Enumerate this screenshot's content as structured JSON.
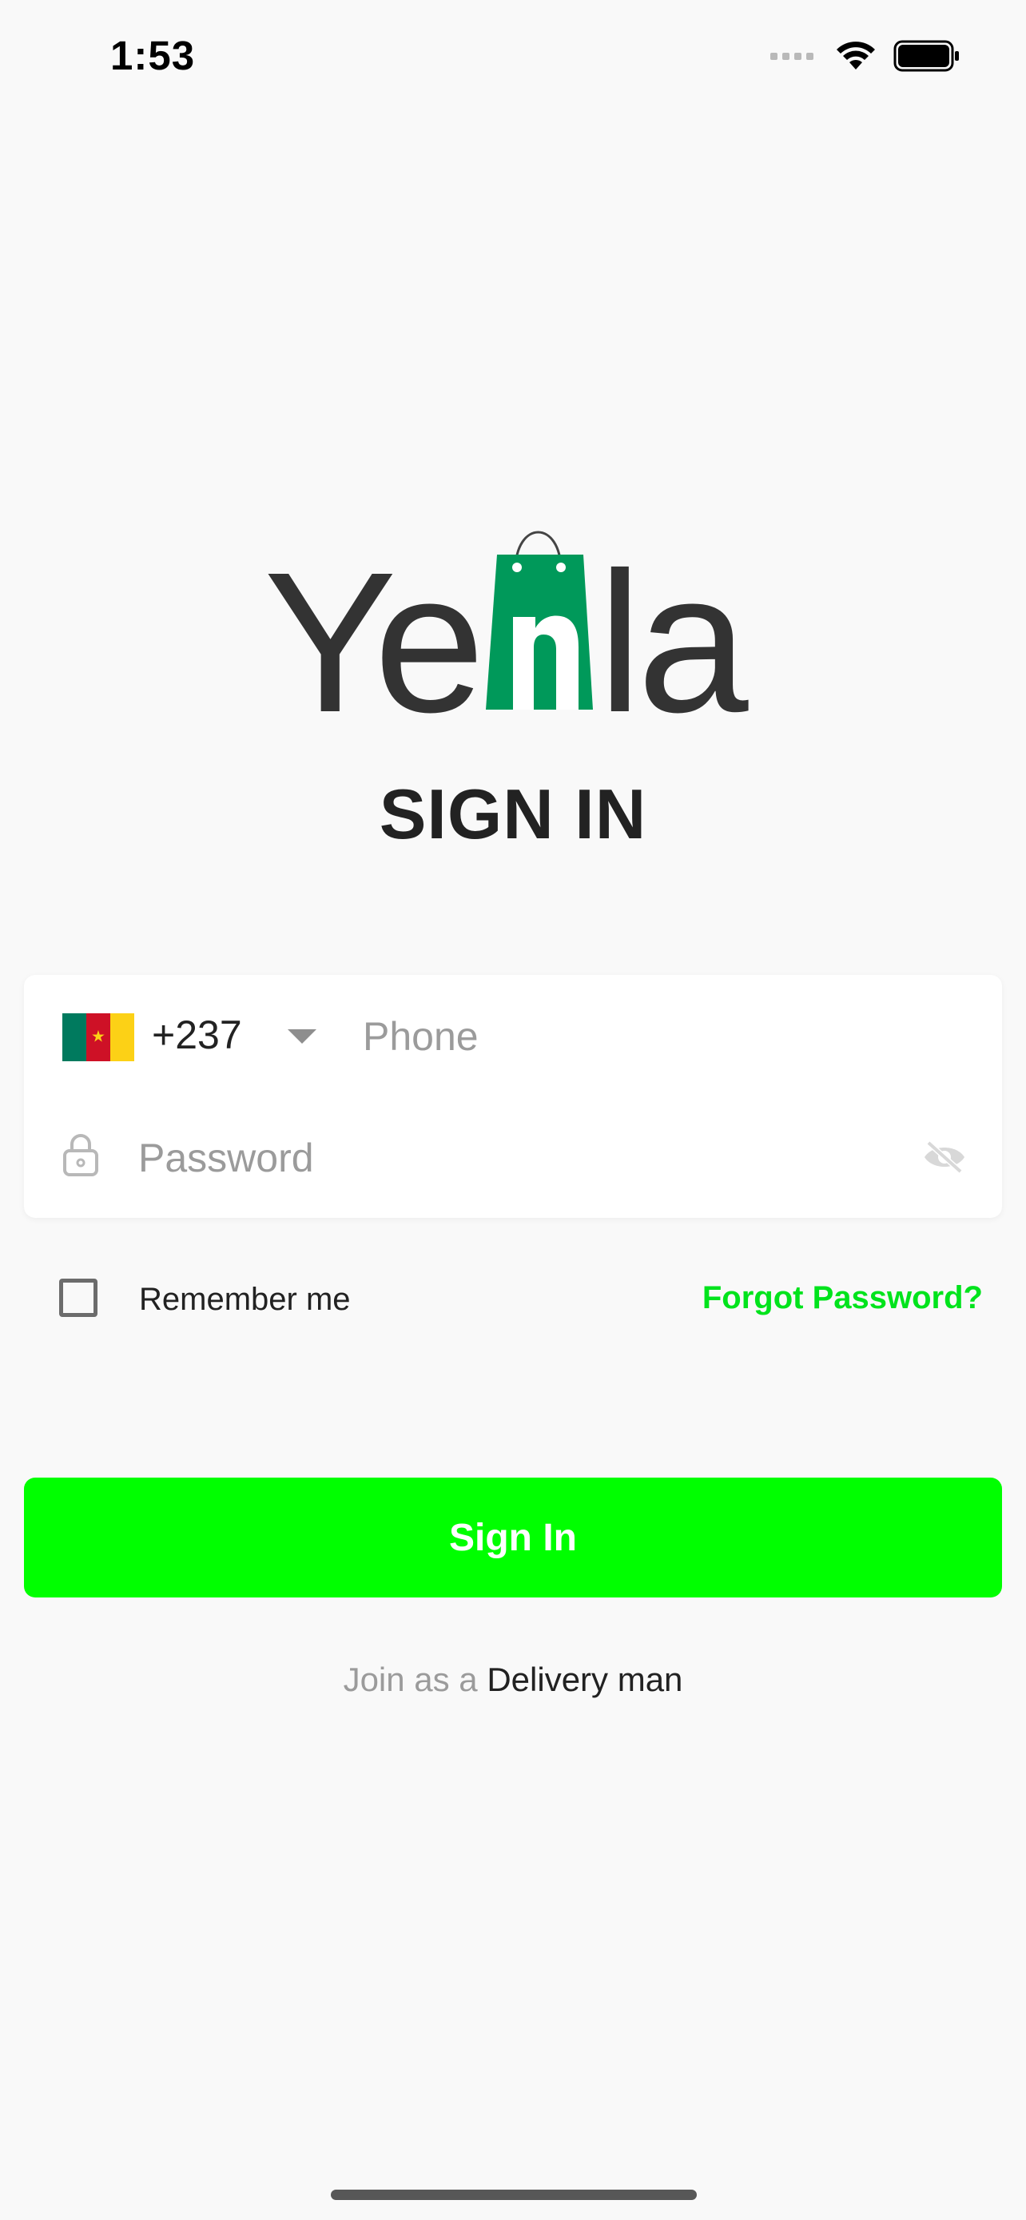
{
  "status_bar": {
    "time": "1:53",
    "icons": [
      "signal-icon",
      "wifi-icon",
      "battery-icon"
    ]
  },
  "logo": {
    "text": "Yenla",
    "icon": "shopping-bag-icon",
    "colors": {
      "text": "#333333",
      "bag": "#00995a"
    }
  },
  "title": "SIGN IN",
  "form": {
    "country_code": "+237",
    "country_flag": "cameroon-flag-icon",
    "phone_placeholder": "Phone",
    "phone_value": "",
    "password_placeholder": "Password",
    "password_value": ""
  },
  "remember_me": {
    "label": "Remember me",
    "checked": false
  },
  "forgot_password": "Forgot Password?",
  "sign_in_button": "Sign In",
  "join": {
    "prefix": "Join as a ",
    "link": "Delivery man"
  },
  "colors": {
    "accent": "#00ff00",
    "link_green": "#00e31c",
    "background": "#f9f9f9"
  }
}
